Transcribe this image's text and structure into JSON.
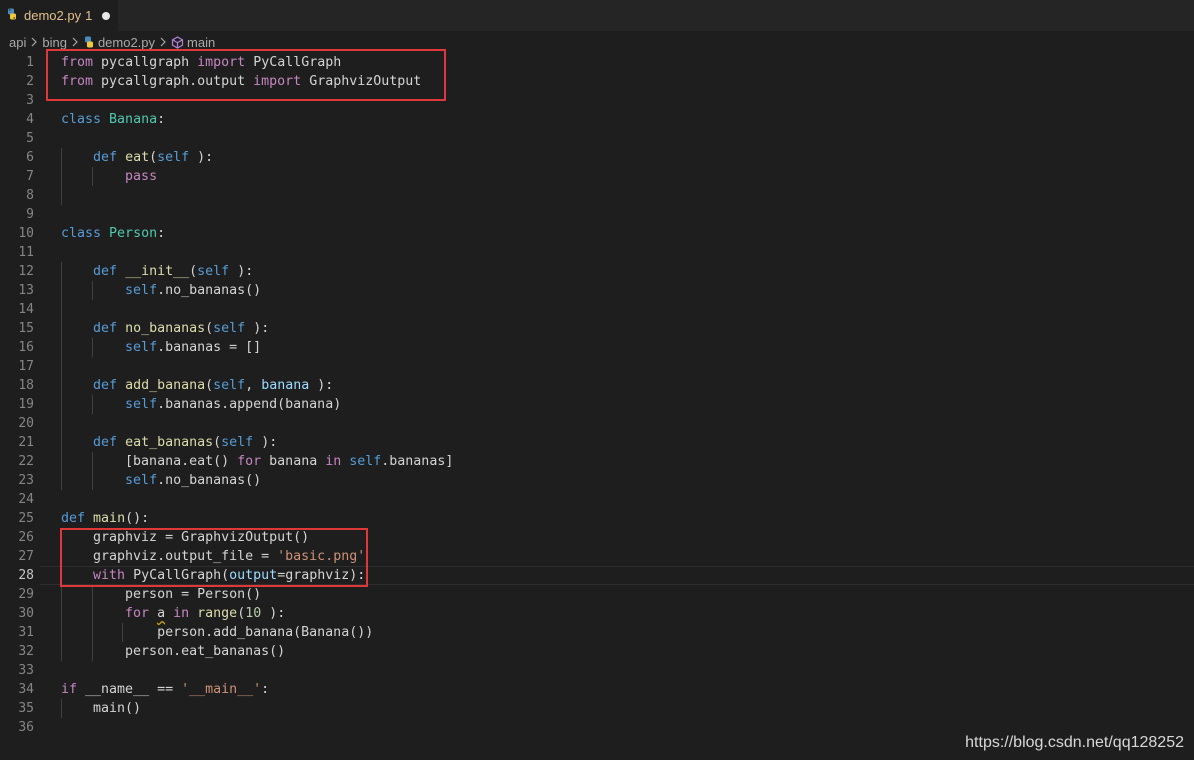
{
  "tab": {
    "filename": "demo2.py",
    "problem_count": "1"
  },
  "breadcrumb": {
    "folder1": "api",
    "folder2": "bing",
    "file": "demo2.py",
    "symbol": "main"
  },
  "colors": {
    "keyword": "#c586c0",
    "storage": "#569cd6",
    "function": "#dcdcaa",
    "class": "#4ec9b0",
    "string": "#ce9178",
    "number": "#b5cea8",
    "highlight_box": "#e0383a"
  },
  "editor": {
    "active_line": 28,
    "line_numbers": [
      "1",
      "2",
      "3",
      "4",
      "5",
      "6",
      "7",
      "8",
      "9",
      "10",
      "11",
      "12",
      "13",
      "14",
      "15",
      "16",
      "17",
      "18",
      "19",
      "20",
      "21",
      "22",
      "23",
      "24",
      "25",
      "26",
      "27",
      "28",
      "29",
      "30",
      "31",
      "32",
      "33",
      "34",
      "35",
      "36"
    ],
    "lines": [
      [
        [
          "kw",
          "from"
        ],
        [
          "",
          "pycallgraph "
        ],
        [
          "kw",
          "import"
        ],
        [
          "",
          "PyCallGraph"
        ]
      ],
      [
        [
          "kw",
          "from"
        ],
        [
          "",
          "pycallgraph.output "
        ],
        [
          "kw",
          "import"
        ],
        [
          "",
          "GraphvizOutput"
        ]
      ],
      [],
      [
        [
          "st",
          "class"
        ],
        [
          "cls",
          "Banana"
        ],
        [
          "",
          ":"
        ]
      ],
      [],
      [
        [
          "",
          "    "
        ],
        [
          "st",
          "def"
        ],
        [
          "fn",
          "eat"
        ],
        [
          "",
          "("
        ],
        [
          "slf",
          "self"
        ],
        [
          "",
          "):"
        ]
      ],
      [
        [
          "",
          "        "
        ],
        [
          "kw",
          "pass"
        ]
      ],
      [],
      [],
      [
        [
          "st",
          "class"
        ],
        [
          "cls",
          "Person"
        ],
        [
          "",
          ":"
        ]
      ],
      [],
      [
        [
          "",
          "    "
        ],
        [
          "st",
          "def"
        ],
        [
          "fn",
          "__init__"
        ],
        [
          "",
          "("
        ],
        [
          "slf",
          "self"
        ],
        [
          "",
          "):"
        ]
      ],
      [
        [
          "",
          "        "
        ],
        [
          "slf",
          "self"
        ],
        [
          "",
          ".no_bananas()"
        ]
      ],
      [],
      [
        [
          "",
          "    "
        ],
        [
          "st",
          "def"
        ],
        [
          "fn",
          "no_bananas"
        ],
        [
          "",
          "("
        ],
        [
          "slf",
          "self"
        ],
        [
          "",
          "):"
        ]
      ],
      [
        [
          "",
          "        "
        ],
        [
          "slf",
          "self"
        ],
        [
          "",
          ".bananas = []"
        ]
      ],
      [],
      [
        [
          "",
          "    "
        ],
        [
          "st",
          "def"
        ],
        [
          "fn",
          "add_banana"
        ],
        [
          "",
          "("
        ],
        [
          "slf",
          "self"
        ],
        [
          "",
          ", "
        ],
        [
          "prm",
          "banana"
        ],
        [
          "",
          "):"
        ]
      ],
      [
        [
          "",
          "        "
        ],
        [
          "slf",
          "self"
        ],
        [
          "",
          ".bananas.append(banana)"
        ]
      ],
      [],
      [
        [
          "",
          "    "
        ],
        [
          "st",
          "def"
        ],
        [
          "fn",
          "eat_bananas"
        ],
        [
          "",
          "("
        ],
        [
          "slf",
          "self"
        ],
        [
          "",
          "):"
        ]
      ],
      [
        [
          "",
          "        [banana.eat() "
        ],
        [
          "kw",
          "for"
        ],
        [
          "",
          "banana "
        ],
        [
          "kw",
          "in"
        ],
        [
          "slf",
          "self"
        ],
        [
          "",
          ".bananas]"
        ]
      ],
      [
        [
          "",
          "        "
        ],
        [
          "slf",
          "self"
        ],
        [
          "",
          ".no_bananas()"
        ]
      ],
      [],
      [
        [
          "st",
          "def"
        ],
        [
          "fn",
          "main"
        ],
        [
          "",
          "():"
        ]
      ],
      [
        [
          "",
          "    graphviz = GraphvizOutput()"
        ]
      ],
      [
        [
          "",
          "    graphviz.output_file = "
        ],
        [
          "str",
          "'basic.png'"
        ]
      ],
      [
        [
          "",
          "    "
        ],
        [
          "kw",
          "with"
        ],
        [
          "",
          "PyCallGraph("
        ],
        [
          "prm",
          "output"
        ],
        [
          "",
          "=graphviz):"
        ]
      ],
      [
        [
          "",
          "        person = Person()"
        ]
      ],
      [
        [
          "",
          "        "
        ],
        [
          "kw",
          "for"
        ],
        [
          "warn",
          "a"
        ],
        [
          "kw",
          "in"
        ],
        [
          "fn",
          "range"
        ],
        [
          "",
          "("
        ],
        [
          "num",
          "10"
        ],
        [
          "",
          "):"
        ]
      ],
      [
        [
          "",
          "            person.add_banana(Banana())"
        ]
      ],
      [
        [
          "",
          "        person.eat_bananas()"
        ]
      ],
      [],
      [
        [
          "kw",
          "if"
        ],
        [
          "",
          "__name__ == "
        ],
        [
          "str",
          "'__main__'"
        ],
        [
          "",
          ":"
        ]
      ],
      [
        [
          "",
          "    main()"
        ]
      ],
      []
    ]
  },
  "watermark": "https://blog.csdn.net/qq128252"
}
